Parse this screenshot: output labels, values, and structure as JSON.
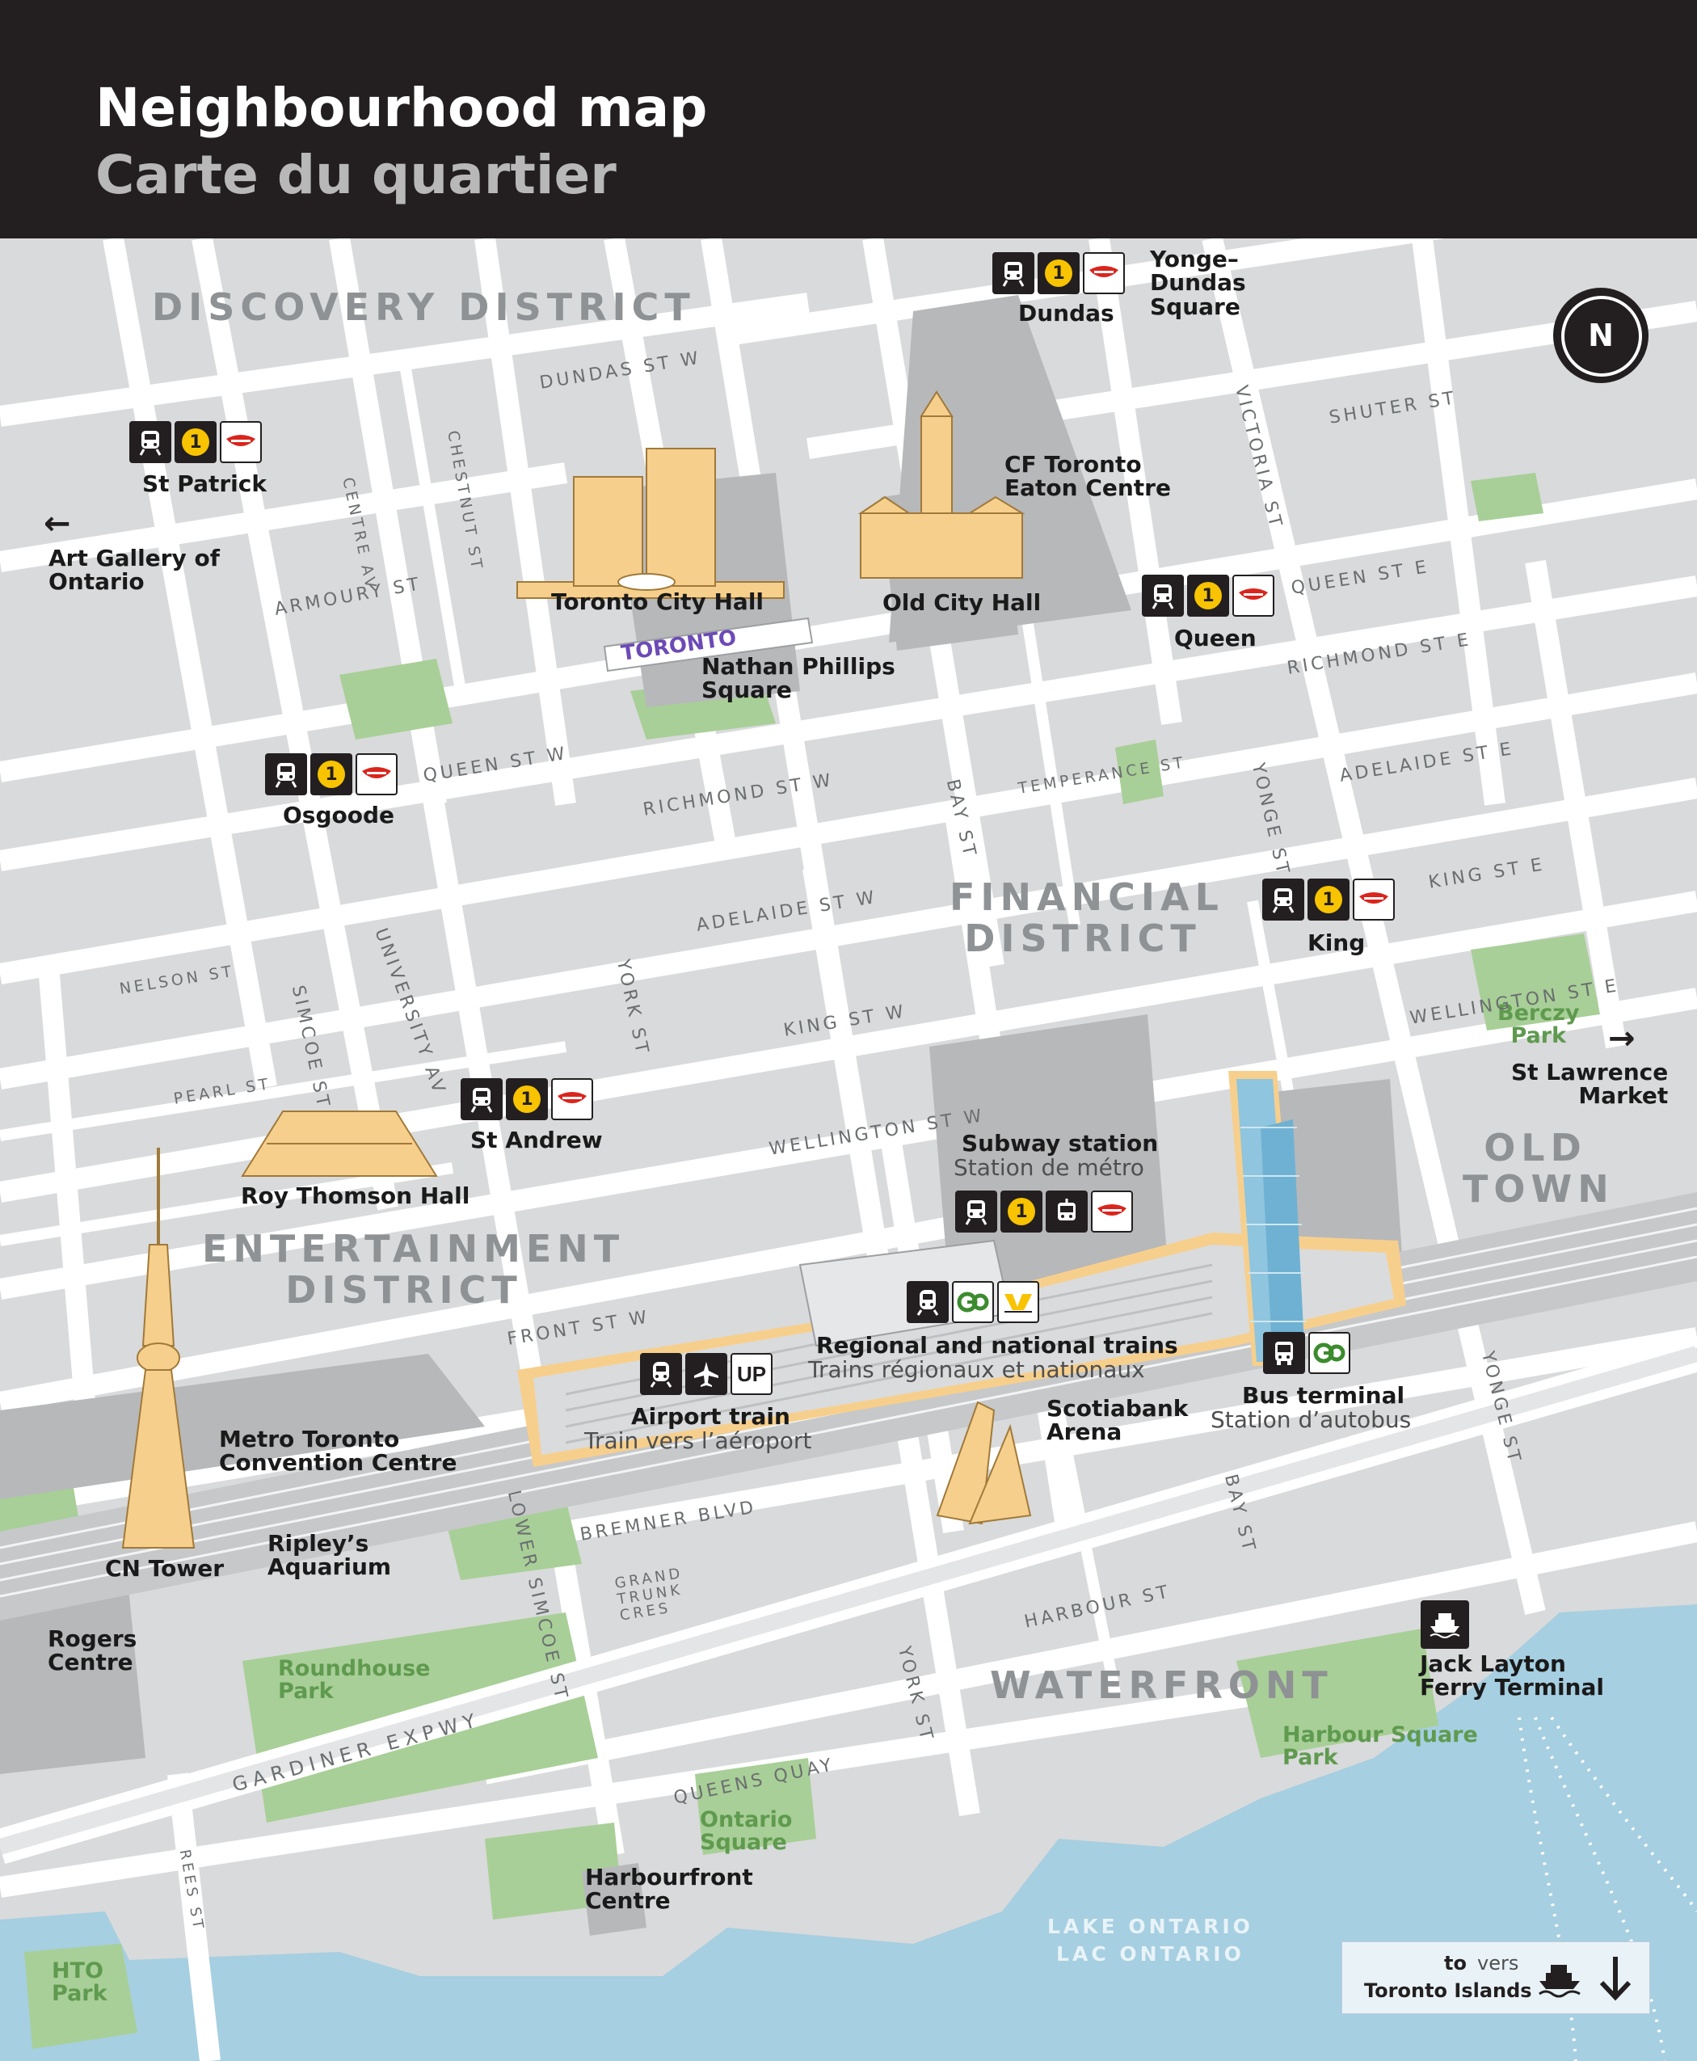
{
  "header": {
    "title_en": "Neighbourhood map",
    "title_fr": "Carte du quartier"
  },
  "compass": {
    "letter": "N"
  },
  "districts": {
    "discovery": "DISCOVERY DISTRICT",
    "financial": "FINANCIAL DISTRICT",
    "entertainment": "ENTERTAINMENT DISTRICT",
    "old_town": "OLD TOWN",
    "waterfront": "WATERFRONT"
  },
  "stations": {
    "dundas": "Dundas",
    "st_patrick": "St Patrick",
    "queen": "Queen",
    "osgoode": "Osgoode",
    "king": "King",
    "st_andrew": "St Andrew"
  },
  "station_line": "1",
  "landmarks": {
    "yonge_dundas": "Yonge–\nDundas\nSquare",
    "eaton": "CF Toronto\nEaton Centre",
    "city_hall": "Toronto City Hall",
    "old_city_hall": "Old City Hall",
    "nathan_phillips": "Nathan Phillips\nSquare",
    "art_gallery": "Art Gallery of\nOntario",
    "roy_thomson": "Roy Thomson Hall",
    "st_lawrence": "St Lawrence\nMarket",
    "metro_convention": "Metro Toronto\nConvention Centre",
    "cn_tower": "CN Tower",
    "ripleys": "Ripley’s\nAquarium",
    "rogers": "Rogers\nCentre",
    "scotiabank": "Scotiabank\nArena",
    "jack_layton": "Jack Layton\nFerry Terminal",
    "harbourfront": "Harbourfront\nCentre",
    "toronto_sign": "TORONTO"
  },
  "parks": {
    "berczy": "Berczy\nPark",
    "roundhouse": "Roundhouse\nPark",
    "harbour_square": "Harbour Square\nPark",
    "ontario_square": "Ontario\nSquare",
    "hto": "HTO\nPark"
  },
  "union": {
    "subway_en": "Subway station",
    "subway_fr": "Station de métro",
    "regional_en": "Regional and national trains",
    "regional_fr": "Trains régionaux et nationaux",
    "airport_en": "Airport train",
    "airport_fr": "Train vers l’aéroport",
    "airport_badge": "UP",
    "bus_en": "Bus terminal",
    "bus_fr": "Station d’autobus"
  },
  "streets": {
    "dundas_w": "DUNDAS ST W",
    "shuter": "SHUTER ST",
    "victoria": "VICTORIA ST",
    "chestnut": "CHESTNUT ST",
    "centre_av": "CENTRE AV",
    "armoury": "ARMOURY ST",
    "queen_e": "QUEEN ST E",
    "richmond_e": "RICHMOND ST E",
    "queen_w": "QUEEN ST W",
    "richmond_w": "RICHMOND ST W",
    "temperance": "TEMPERANCE ST",
    "adelaide_e": "ADELAIDE ST E",
    "bay": "BAY ST",
    "yonge": "YONGE ST",
    "king_e": "KING ST E",
    "adelaide_w": "ADELAIDE ST W",
    "university": "UNIVERSITY AV",
    "nelson": "NELSON ST",
    "simcoe": "SIMCOE ST",
    "york": "YORK ST",
    "wellington_e": "WELLINGTON ST E",
    "king_w": "KING ST W",
    "pearl": "PEARL ST",
    "wellington_w": "WELLINGTON ST W",
    "front_w": "FRONT ST W",
    "lower_simcoe": "LOWER SIMCOE ST",
    "bremner": "BREMNER BLVD",
    "grand_trunk": "GRAND\nTRUNK\nCRES",
    "harbour": "HARBOUR ST",
    "gardiner": "GARDINER EXPWY",
    "queens_quay": "QUEENS QUAY",
    "rees": "REES ST"
  },
  "lake": {
    "en": "LAKE ONTARIO",
    "fr": "LAC ONTARIO"
  },
  "islands": {
    "to": "to",
    "vers": "vers",
    "name": "Toronto Islands"
  },
  "colors": {
    "header_bg": "#231f20",
    "land": "#d9dadb",
    "block": "#c8c9cb",
    "road": "#ffffff",
    "park": "#a8cf97",
    "water": "#a6cfe1",
    "landmark_gold": "#f7cf8c",
    "ttc_red": "#da251d",
    "line1_yellow": "#f8c300",
    "go_green": "#3c8b2e"
  },
  "icons": [
    "subway-icon",
    "line-1-icon",
    "ttc-logo-icon",
    "streetcar-icon",
    "train-icon",
    "go-transit-icon",
    "via-rail-icon",
    "airplane-icon",
    "bus-icon",
    "ferry-icon",
    "compass-icon",
    "arrow-left-icon",
    "arrow-right-icon",
    "arrow-down-icon"
  ]
}
